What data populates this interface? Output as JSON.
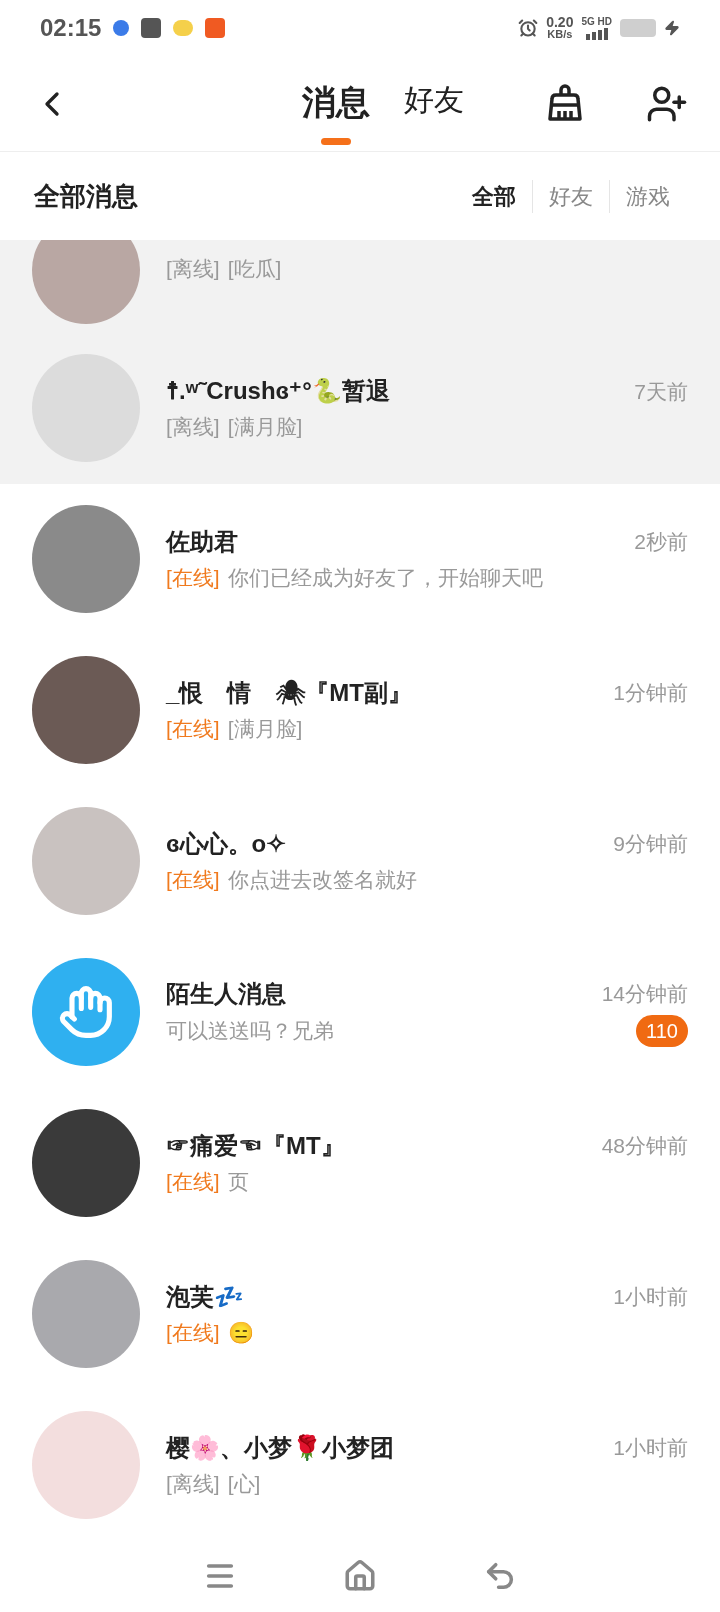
{
  "status_bar": {
    "time": "02:15",
    "speed": "0.20",
    "speed_unit": "KB/s",
    "network": "5G HD"
  },
  "header": {
    "tabs": [
      {
        "label": "消息",
        "selected": true
      },
      {
        "label": "好友",
        "selected": false
      }
    ]
  },
  "filter": {
    "title": "全部消息",
    "options": [
      {
        "label": "全部",
        "selected": true
      },
      {
        "label": "好友",
        "selected": false
      },
      {
        "label": "游戏",
        "selected": false
      }
    ]
  },
  "conversations": [
    {
      "kind": "partial",
      "highlighted": true,
      "online": false,
      "status_label": "[离线]",
      "preview": "[吃瓜]"
    },
    {
      "kind": "friend",
      "highlighted": true,
      "name": "☨.ʷ˜Crushɞ⁺°🐍暂退",
      "time": "7天前",
      "online": false,
      "status_label": "[离线]",
      "preview": "[满月脸]"
    },
    {
      "kind": "friend",
      "highlighted": false,
      "name": "佐助君",
      "time": "2秒前",
      "online": true,
      "status_label": "[在线]",
      "preview": "你们已经成为好友了，开始聊天吧"
    },
    {
      "kind": "friend",
      "highlighted": false,
      "name": "_恨　情　🕷『MT副』",
      "time": "1分钟前",
      "online": true,
      "status_label": "[在线]",
      "preview": "[满月脸]"
    },
    {
      "kind": "friend",
      "highlighted": false,
      "name": "ɞ心心。o✧",
      "time": "9分钟前",
      "online": true,
      "status_label": "[在线]",
      "preview": "你点进去改签名就好"
    },
    {
      "kind": "stranger",
      "highlighted": false,
      "name": "陌生人消息",
      "time": "14分钟前",
      "preview": "可以送送吗？兄弟",
      "badge": "110"
    },
    {
      "kind": "friend",
      "highlighted": false,
      "name": "☞痛爱☜『MT』",
      "time": "48分钟前",
      "online": true,
      "status_label": "[在线]",
      "preview": "页"
    },
    {
      "kind": "friend",
      "highlighted": false,
      "name": "泡芙💤",
      "time": "1小时前",
      "online": true,
      "status_label": "[在线]",
      "preview": "😑"
    },
    {
      "kind": "friend",
      "highlighted": false,
      "name": "樱🌸、小梦🌹小梦团",
      "time": "1小时前",
      "online": false,
      "status_label": "[离线]",
      "preview": "[心]"
    }
  ]
}
